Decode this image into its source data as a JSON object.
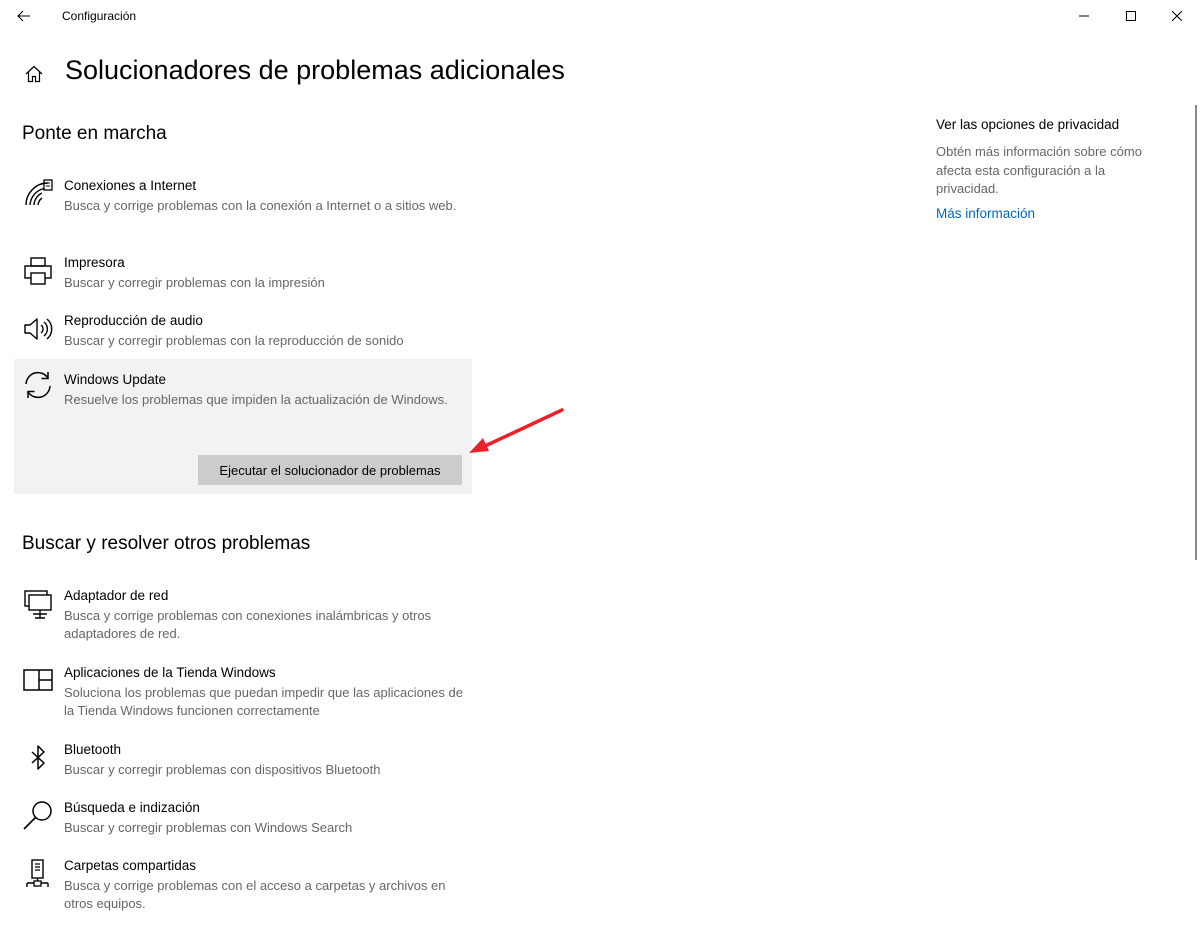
{
  "window": {
    "title": "Configuración"
  },
  "header": {
    "page_title": "Solucionadores de problemas adicionales"
  },
  "sections": {
    "get_going": "Ponte en marcha",
    "find_fix": "Buscar y resolver otros problemas"
  },
  "get_going_items": [
    {
      "name": "Conexiones a Internet",
      "description": "Busca y corrige problemas con la conexión a Internet o a sitios web.",
      "icon": "wifi-icon"
    },
    {
      "name": "Impresora",
      "description": "Buscar y corregir problemas con la impresión",
      "icon": "printer-icon"
    },
    {
      "name": "Reproducción de audio",
      "description": "Buscar y corregir problemas con la reproducción de sonido",
      "icon": "speaker-icon"
    },
    {
      "name": "Windows Update",
      "description": "Resuelve los problemas que impiden la actualización de Windows.",
      "icon": "refresh-icon",
      "selected": true
    }
  ],
  "run_button_label": "Ejecutar el solucionador de problemas",
  "other_items": [
    {
      "name": "Adaptador de red",
      "description": "Busca y corrige problemas con conexiones inalámbricas y otros adaptadores de red.",
      "icon": "network-adapter-icon"
    },
    {
      "name": "Aplicaciones de la Tienda Windows",
      "description": "Soluciona los problemas que puedan impedir que las aplicaciones de la Tienda Windows funcionen correctamente",
      "icon": "store-app-icon"
    },
    {
      "name": "Bluetooth",
      "description": "Buscar y corregir problemas con dispositivos Bluetooth",
      "icon": "bluetooth-icon"
    },
    {
      "name": "Búsqueda e indización",
      "description": "Buscar y corregir problemas con Windows Search",
      "icon": "search-icon"
    },
    {
      "name": "Carpetas compartidas",
      "description": "Busca y corrige problemas con el acceso a carpetas y archivos en otros equipos.",
      "icon": "shared-folder-icon"
    }
  ],
  "sidebar": {
    "title": "Ver las opciones de privacidad",
    "description": "Obtén más información sobre cómo afecta esta configuración a la privacidad.",
    "link": "Más información"
  },
  "colors": {
    "accent_link": "#0067c0",
    "selected_bg": "#f2f2f2",
    "button_bg": "#cccccc",
    "arrow": "#e8212b"
  }
}
